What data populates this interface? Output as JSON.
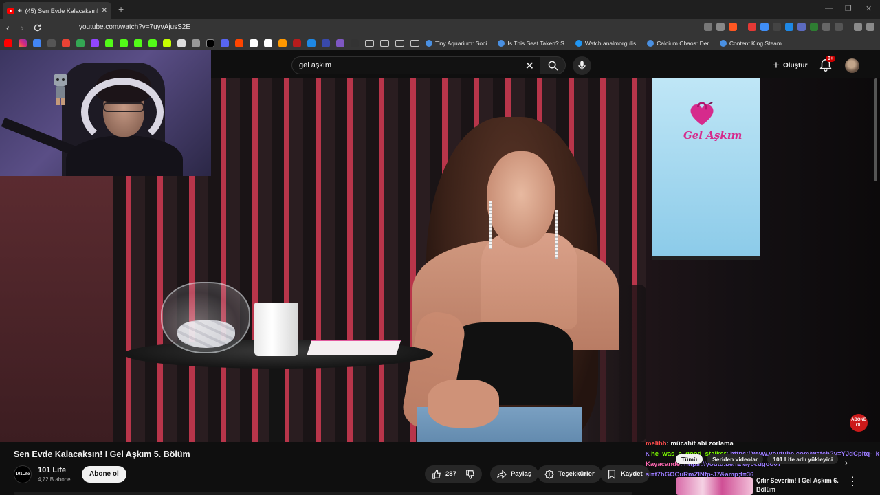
{
  "browser": {
    "tab_title": "(45) Sen Evde Kalacaksın! I Ge",
    "new_tab": "+",
    "url": "youtube.com/watch?v=7uyvAjusS2E",
    "win_min": "—",
    "win_max": "❐",
    "win_close": "✕",
    "bookmarks": [
      {
        "label": "Tiny Aquarium: Soci..."
      },
      {
        "label": "Is This Seat Taken? S..."
      },
      {
        "label": "Watch analmorgulis..."
      },
      {
        "label": "Calcium Chaos: Der..."
      },
      {
        "label": "Content King Steam..."
      }
    ]
  },
  "header": {
    "search_value": "gel aşkım",
    "create_label": "Oluştur",
    "notif_count": "9+"
  },
  "video": {
    "logo_text": "Gel Aşkım",
    "subscribe_badge": "ABONE OL"
  },
  "meta": {
    "title": "Sen Evde Kalacaksın! I Gel Aşkım 5. Bölüm",
    "channel_avatar_text": "101Life",
    "channel_name": "101 Life",
    "subscribers": "4,72 B abone",
    "subscribe_button": "Abone ol",
    "like_count": "287",
    "share_label": "Paylaş",
    "thanks_label": "Teşekkürler",
    "save_label": "Kaydet"
  },
  "chat": [
    {
      "user": "melihh",
      "user_color": "#ff4d4d",
      "text": ": mücahit abi zorlama",
      "text_color": "#f1f1f1"
    },
    {
      "user": "he_was_a_good_stalker",
      "user_color": "#7cfc00",
      "text": ": https://www.youtube.com/watch?v=YJdCpltq-_k",
      "text_color": "#9b7bff"
    },
    {
      "user": "Kayacande",
      "user_color": "#ff69b4",
      "text": ": https://youtu.be/fEMy0cugoo0?",
      "text_color": "#9b7bff"
    },
    {
      "user": "",
      "user_color": "#9b7bff",
      "text": "si=t7hGOCuRmZINfp-J7&amp;t=36",
      "text_color": "#9b7bff"
    }
  ],
  "chips": [
    "Tümü",
    "Seriden videolar",
    "101 Life adlı yükleyici"
  ],
  "recommendation": {
    "title": "Çıtır Severim! I Gel Aşkım 6. Bölüm"
  },
  "colors": {
    "accent_red": "#ff0000",
    "bg": "#0f0f0f",
    "logo_pink": "#d62a8c"
  }
}
